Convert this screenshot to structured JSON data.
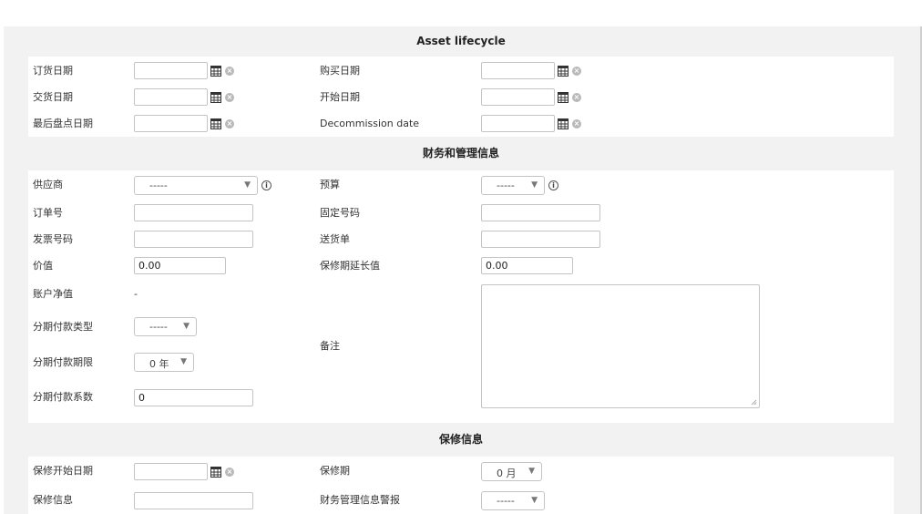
{
  "sections": {
    "lifecycle": "Asset lifecycle",
    "financial": "财务和管理信息",
    "warranty": "保修信息"
  },
  "lifecycle": {
    "order_date": {
      "label": "订货日期",
      "value": ""
    },
    "purchase_date": {
      "label": "购买日期",
      "value": ""
    },
    "delivery_date": {
      "label": "交货日期",
      "value": ""
    },
    "start_date": {
      "label": "开始日期",
      "value": ""
    },
    "last_inventory_date": {
      "label": "最后盘点日期",
      "value": ""
    },
    "decommission_date": {
      "label": "Decommission date",
      "value": ""
    }
  },
  "financial": {
    "supplier": {
      "label": "供应商",
      "value": "-----"
    },
    "budget": {
      "label": "预算",
      "value": "-----"
    },
    "order_number": {
      "label": "订单号",
      "value": ""
    },
    "immobilization_number": {
      "label": "固定号码",
      "value": ""
    },
    "invoice_number": {
      "label": "发票号码",
      "value": ""
    },
    "delivery_note": {
      "label": "送货单",
      "value": ""
    },
    "value": {
      "label": "价值",
      "value": "0.00"
    },
    "warranty_extension_value": {
      "label": "保修期延长值",
      "value": "0.00"
    },
    "net_book_value": {
      "label": "账户净值",
      "value": "-"
    },
    "amortization_type": {
      "label": "分期付款类型",
      "value": "-----"
    },
    "amortization_duration": {
      "label": "分期付款期限",
      "value": "0 年"
    },
    "amortization_coeff": {
      "label": "分期付款系数",
      "value": "0"
    },
    "comments": {
      "label": "备注",
      "value": ""
    }
  },
  "warranty": {
    "start_date": {
      "label": "保修开始日期",
      "value": ""
    },
    "duration": {
      "label": "保修期",
      "value": "0 月"
    },
    "info": {
      "label": "保修信息",
      "value": ""
    },
    "alarm": {
      "label": "财务管理信息警报",
      "value": "-----"
    }
  },
  "icons": {
    "calendar": "calendar-icon",
    "clear": "clear-icon",
    "info": "info-icon",
    "dropdown": "chevron-down-icon"
  },
  "colors": {
    "header_bg": "#f2f2f2",
    "border": "#c4c4c4"
  }
}
